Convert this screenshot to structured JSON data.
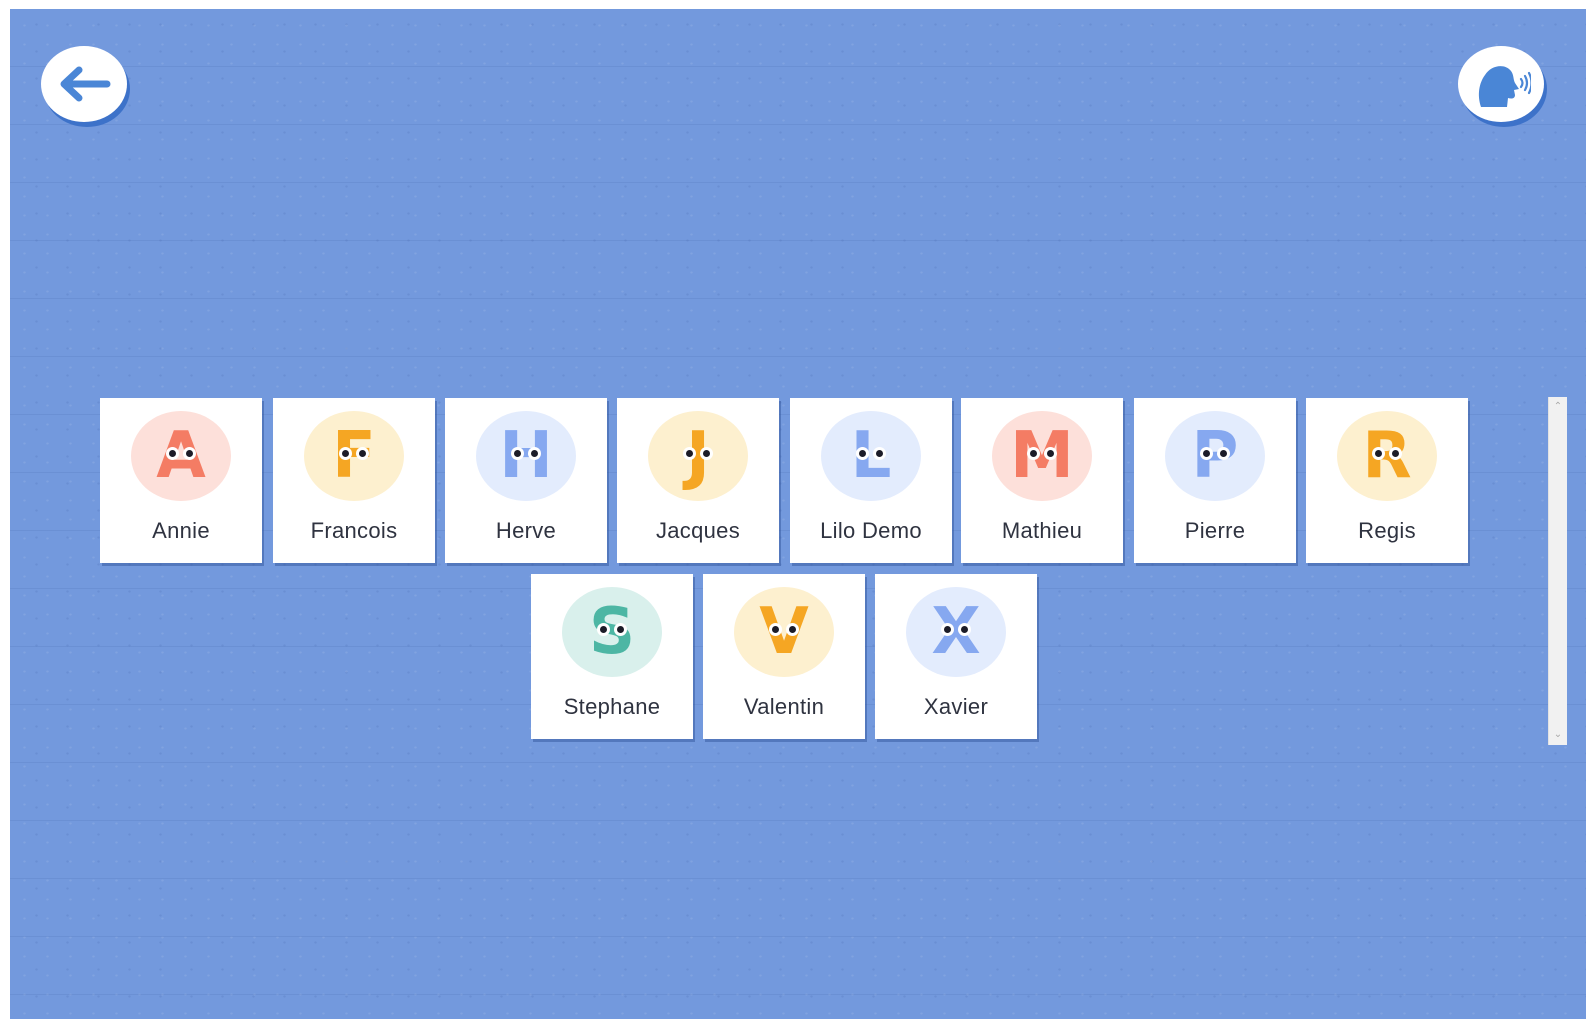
{
  "header": {
    "back_icon": "arrow-left-icon",
    "speak_icon": "speaking-head-icon"
  },
  "colors": {
    "background": "#7399dd",
    "button_shadow": "#3d72c9",
    "card": "#ffffff",
    "name_text": "#2f3340"
  },
  "characters": [
    {
      "name": "Annie",
      "letter": "A",
      "color": "#f47c64",
      "circle": "#fde0da"
    },
    {
      "name": "Francois",
      "letter": "F",
      "color": "#f5a623",
      "circle": "#fdf0cf"
    },
    {
      "name": "Herve",
      "letter": "H",
      "color": "#86a8f0",
      "circle": "#e3ecfd"
    },
    {
      "name": "Jacques",
      "letter": "J",
      "color": "#f5a623",
      "circle": "#fdf0cf"
    },
    {
      "name": "Lilo Demo",
      "letter": "L",
      "color": "#86a8f0",
      "circle": "#e3ecfd"
    },
    {
      "name": "Mathieu",
      "letter": "M",
      "color": "#f47c64",
      "circle": "#fde0da"
    },
    {
      "name": "Pierre",
      "letter": "P",
      "color": "#86a8f0",
      "circle": "#e3ecfd"
    },
    {
      "name": "Regis",
      "letter": "R",
      "color": "#f5a623",
      "circle": "#fdf0cf"
    },
    {
      "name": "Stephane",
      "letter": "S",
      "color": "#4db6a4",
      "circle": "#d9f0ec"
    },
    {
      "name": "Valentin",
      "letter": "V",
      "color": "#f5a623",
      "circle": "#fdf0cf"
    },
    {
      "name": "Xavier",
      "letter": "X",
      "color": "#86a8f0",
      "circle": "#e3ecfd"
    }
  ]
}
